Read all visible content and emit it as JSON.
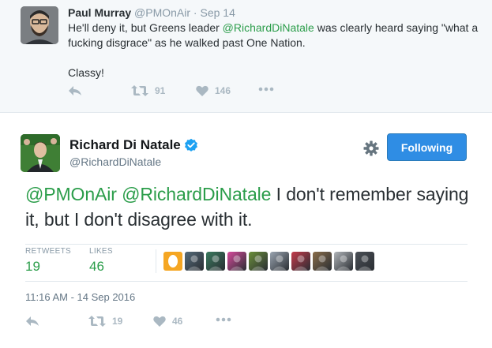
{
  "parent_tweet": {
    "name": "Paul Murray",
    "handle": "@PMOnAir",
    "dot": "·",
    "date": "Sep 14",
    "text_part1": "He'll deny it, but Greens leader ",
    "mention": "@RichardDiNatale",
    "text_part2": " was clearly heard saying \"what a fucking disgrace\" as he walked past One Nation.",
    "text_line2": "Classy!",
    "retweets": "91",
    "likes": "146",
    "icons": [
      "reply-icon",
      "retweet-icon",
      "heart-icon",
      "more-icon"
    ]
  },
  "main_tweet": {
    "name": "Richard Di Natale",
    "handle": "@RichardDiNatale",
    "follow_label": "Following",
    "mention1": "@PMOnAir",
    "mention2": "@RichardDiNatale",
    "text": " I don't remember saying it, but I don't disagree with it.",
    "retweets_label": "RETWEETS",
    "retweets": "19",
    "likes_label": "LIKES",
    "likes": "46",
    "timestamp": "11:16 AM - 14 Sep 2016",
    "action_retweets": "19",
    "action_likes": "46",
    "likers": [
      "#f5a623",
      "#556b7a",
      "#3a7a5e",
      "#d64a9b",
      "#6b8f3a",
      "#9aa4b0",
      "#c43a4a",
      "#8a6d4a",
      "#b0b4b8",
      "#4a4f55"
    ]
  },
  "colors": {
    "accent_green": "#2b9d4a",
    "follow_blue": "#2f8de4",
    "muted": "#8899a6",
    "icon_gray": "#aab8c2",
    "verified_blue": "#1da1f2"
  }
}
